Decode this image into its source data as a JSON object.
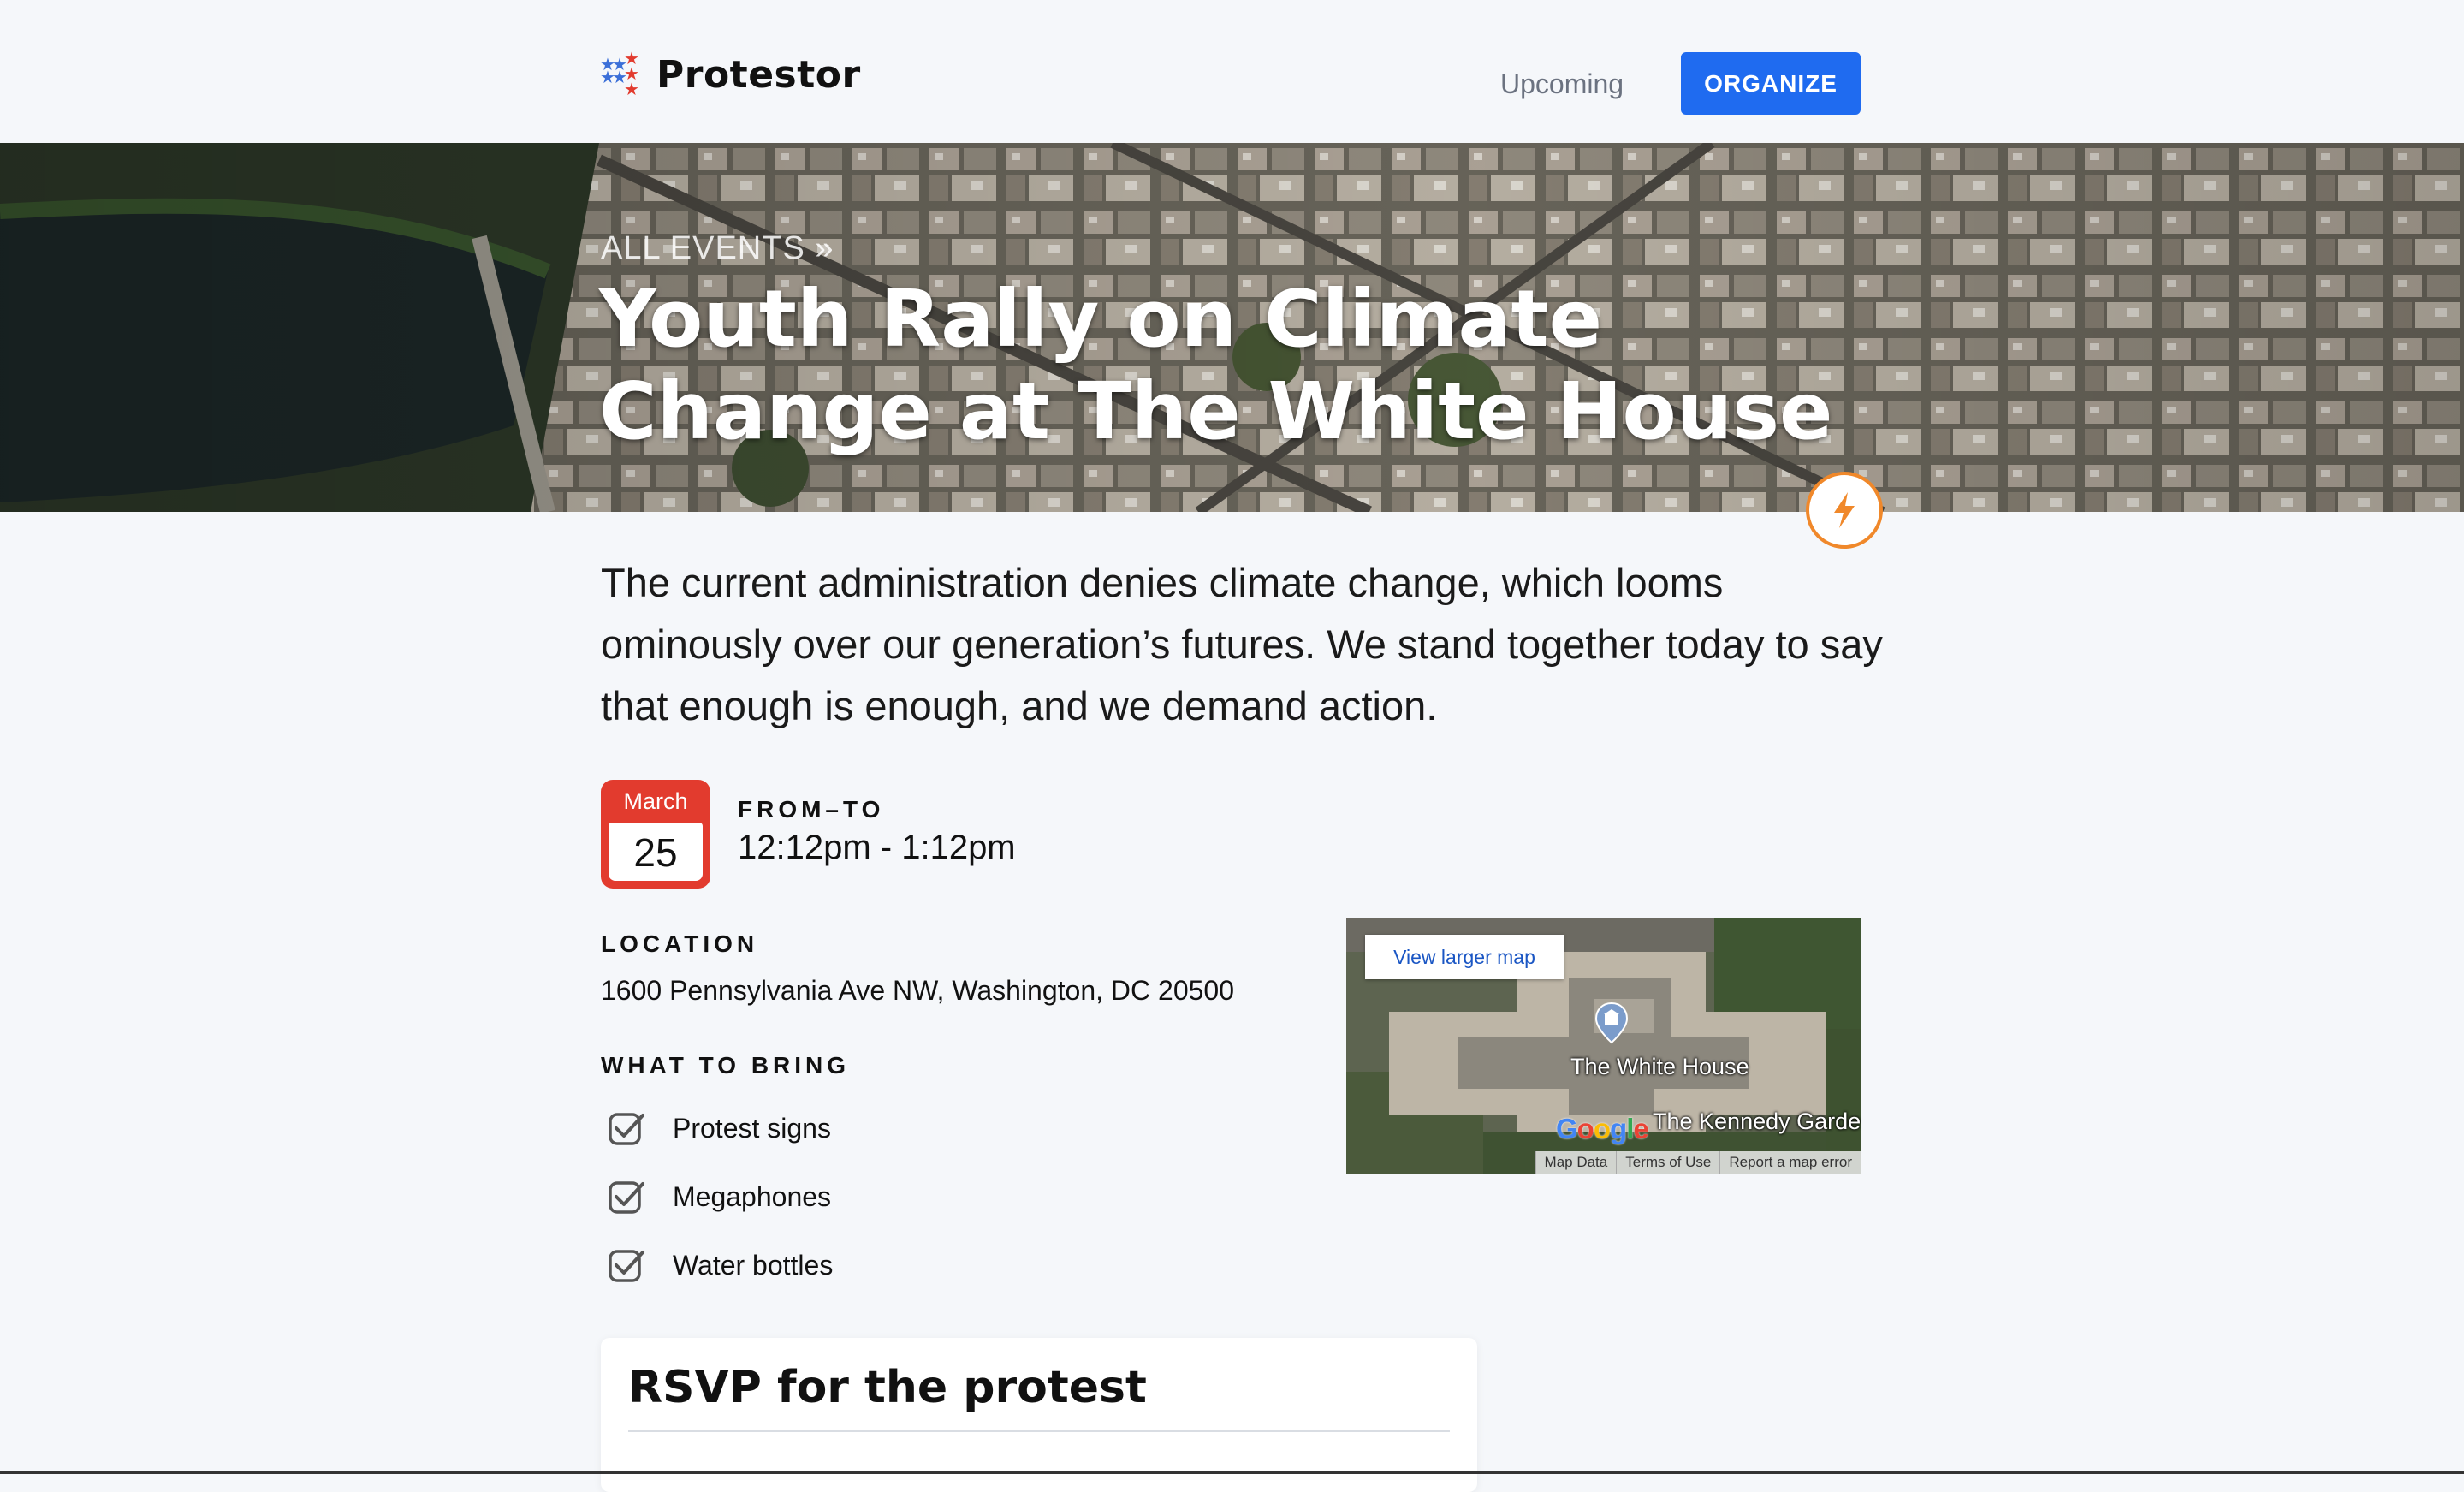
{
  "header": {
    "brand": "Protestor",
    "nav_upcoming": "Upcoming",
    "organize_button": "ORGANIZE"
  },
  "hero": {
    "breadcrumb": "ALL EVENTS »",
    "title": "Youth Rally on Climate Change at The White House",
    "badge_icon": "lightning-icon"
  },
  "event": {
    "description": "The current administration denies climate change, which looms ominously over our generation’s futures. We stand together today to say that enough is enough, and we demand action.",
    "date": {
      "month": "March",
      "day": "25"
    },
    "from_to_label": "FROM–TO",
    "time": "12:12pm - 1:12pm",
    "location_label": "LOCATION",
    "address": "1600 Pennsylvania Ave NW, Washington, DC 20500",
    "bring_label": "WHAT TO BRING",
    "bring_items": [
      "Protest signs",
      "Megaphones",
      "Water bottles"
    ]
  },
  "map": {
    "view_larger": "View larger map",
    "place_label": "The White House",
    "secondary_label": "The Kennedy Garde",
    "google": "Google",
    "footer": [
      "Map Data",
      "Terms of Use",
      "Report a map error"
    ]
  },
  "rsvp": {
    "title": "RSVP for the protest"
  },
  "colors": {
    "accent": "#1f6bf0",
    "calendar": "#e23b2e",
    "badge": "#f0882a"
  }
}
